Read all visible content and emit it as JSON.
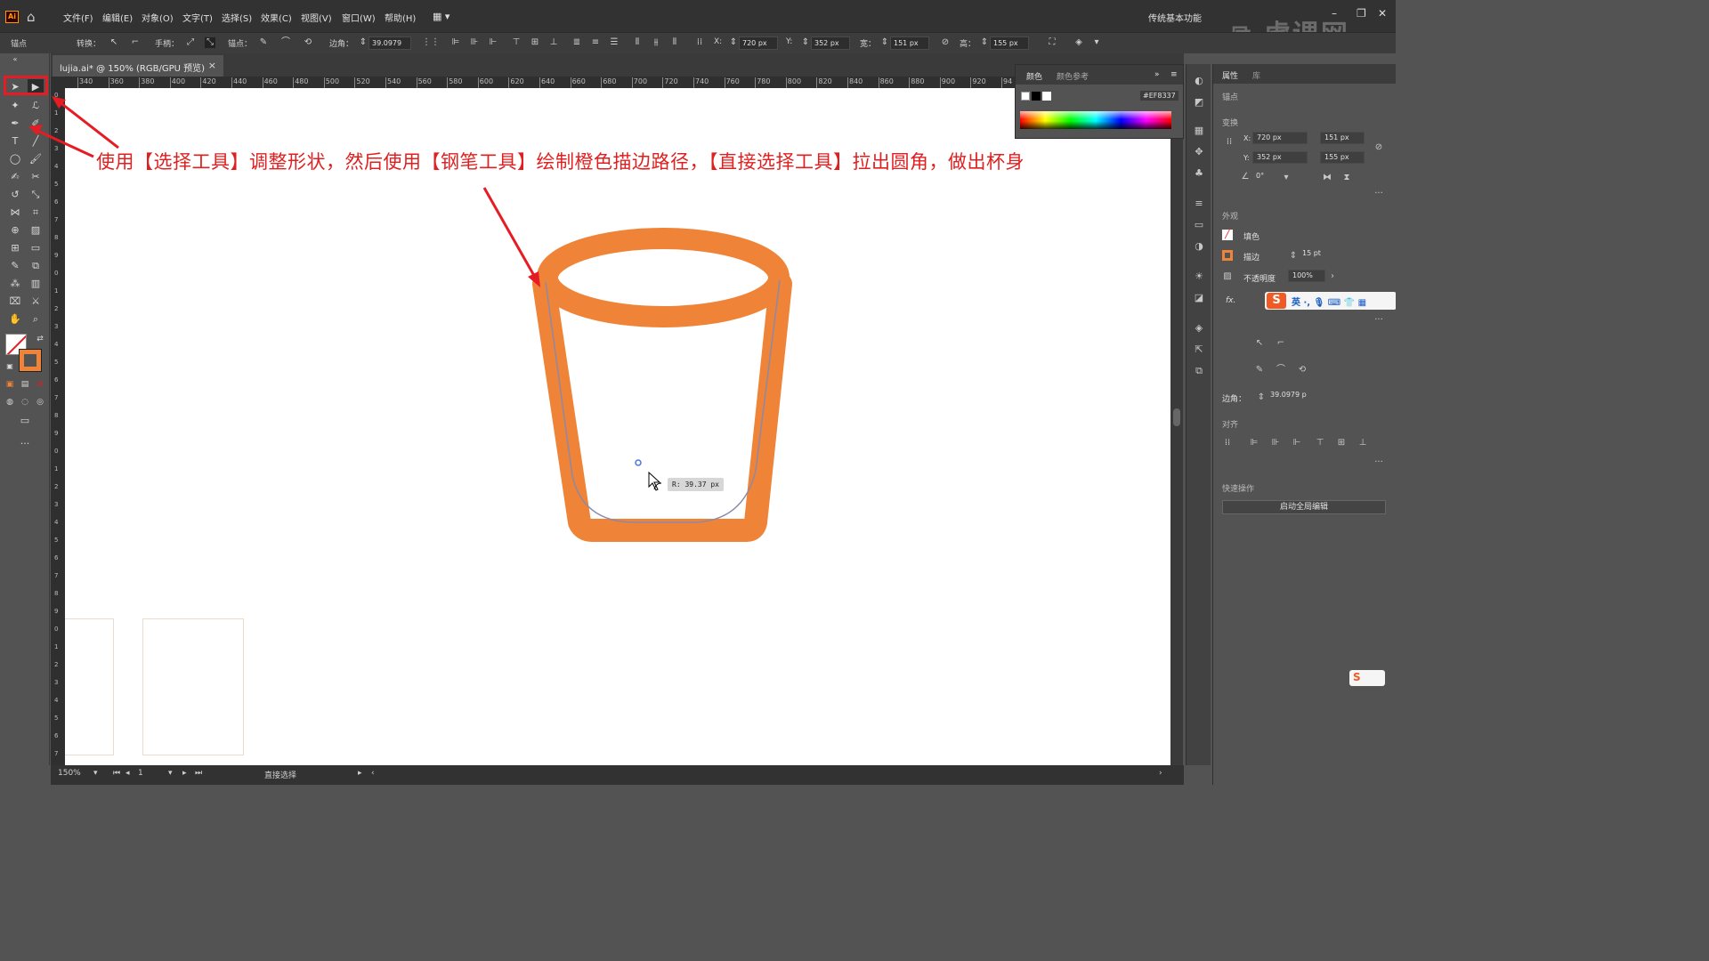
{
  "app": {
    "logo": "Ai",
    "workspace": "传统基本功能"
  },
  "menu": [
    "文件(F)",
    "编辑(E)",
    "对象(O)",
    "文字(T)",
    "选择(S)",
    "效果(C)",
    "视图(V)",
    "窗口(W)",
    "帮助(H)"
  ],
  "control_bar": {
    "anchor_label": "锚点",
    "convert_label": "转换：",
    "handle_label": "手柄：",
    "anchors_label": "锚点：",
    "corner_label": "边角：",
    "corner_value": "39.0979",
    "x_label": "X:",
    "x_value": "720 px",
    "y_label": "Y:",
    "y_value": "352 px",
    "w_label": "宽：",
    "w_value": "151 px",
    "h_label": "高：",
    "h_value": "155 px"
  },
  "document_tab": {
    "title": "lujia.ai* @ 150% (RGB/GPU 预览)",
    "close": "×"
  },
  "ruler_top": [
    "340",
    "360",
    "380",
    "400",
    "420",
    "440",
    "460",
    "480",
    "500",
    "520",
    "540",
    "560",
    "580",
    "600",
    "620",
    "640",
    "660",
    "680",
    "700",
    "720",
    "740",
    "760",
    "780",
    "800",
    "820",
    "840",
    "860",
    "880",
    "900",
    "920",
    "94"
  ],
  "ruler_left": [
    "0",
    "1",
    "2",
    "3",
    "4",
    "5",
    "6",
    "7",
    "8",
    "9",
    "0",
    "1",
    "2",
    "3",
    "4",
    "5",
    "6",
    "7",
    "8",
    "9",
    "0",
    "1",
    "2",
    "3",
    "4",
    "5",
    "6",
    "7",
    "8",
    "9",
    "0",
    "1",
    "2",
    "3",
    "4",
    "5",
    "6",
    "7"
  ],
  "canvas": {
    "annotation": "使用【选择工具】调整形状，然后使用【钢笔工具】绘制橙色描边路径，【直接选择工具】拉出圆角，做出杯身",
    "tooltip": "R: 39.37 px",
    "stroke_color": "#EF8337",
    "path_color": "#8a8aa8",
    "arrow_color": "#e51c23"
  },
  "color_panel": {
    "tab_color": "颜色",
    "tab_guide": "颜色参考",
    "hex_prefix": "#",
    "hex": "EF8337"
  },
  "properties_panel": {
    "tab_props": "属性",
    "tab_lib": "库",
    "selection_type": "锚点",
    "transform_label": "变换",
    "x_label": "X:",
    "x": "720 px",
    "y_label": "Y:",
    "y": "352 px",
    "w": "151 px",
    "h": "155 px",
    "angle": "0°",
    "appearance_label": "外观",
    "fill_label": "填色",
    "stroke_label": "描边",
    "stroke_weight": "15 pt",
    "opacity_label": "不透明度",
    "opacity": "100%",
    "fx_label": "fx.",
    "corner_label": "边角：",
    "corner": "39.0979 p",
    "align_label": "对齐",
    "quick_actions_label": "快速操作",
    "quick_button": "启动全局编辑"
  },
  "ime": {
    "mode": "英"
  },
  "status_bar": {
    "zoom": "150%",
    "page": "1",
    "tool": "直接选择"
  },
  "watermark": "虎课网"
}
